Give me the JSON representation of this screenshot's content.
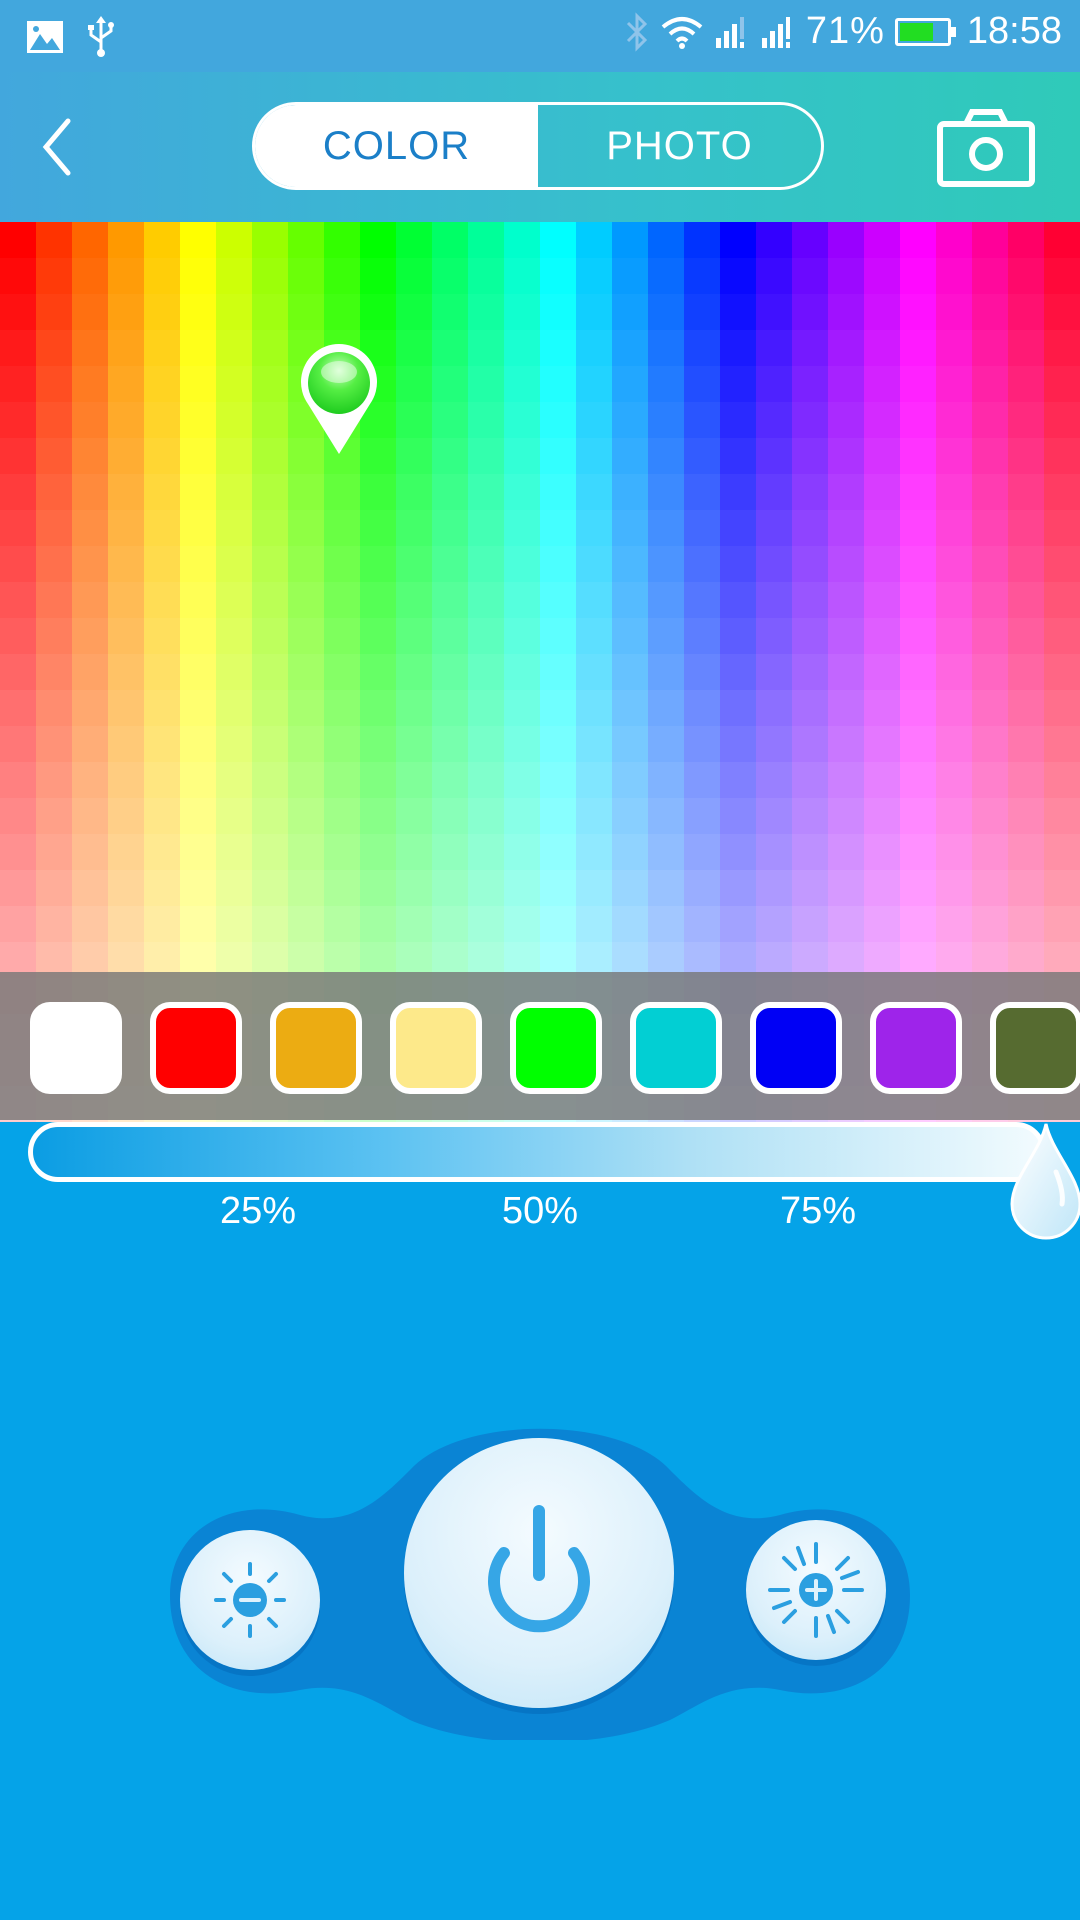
{
  "status_bar": {
    "left_icons": [
      "gallery-icon",
      "usb-icon"
    ],
    "right_icons": [
      "bluetooth-icon",
      "wifi-icon",
      "signal-sim1-icon",
      "signal-sim2-icon"
    ],
    "battery_percent_label": "71%",
    "battery_level": 0.71,
    "battery_color": "#22dd22",
    "time": "18:58"
  },
  "header": {
    "back_icon": "chevron-left-icon",
    "tabs": [
      {
        "label": "COLOR",
        "active": true
      },
      {
        "label": "PHOTO",
        "active": false
      }
    ],
    "camera_icon": "camera-icon",
    "gradient_colors": [
      "#42a7dd",
      "#2fcab9"
    ]
  },
  "color_picker": {
    "hue_columns": 30,
    "selected_color": "#33ee22",
    "picker_icon": "map-pin-icon"
  },
  "swatches": [
    {
      "name": "white",
      "color": "#ffffff"
    },
    {
      "name": "red",
      "color": "#ff0000"
    },
    {
      "name": "orange",
      "color": "#ecac12"
    },
    {
      "name": "light-yellow",
      "color": "#fde98a"
    },
    {
      "name": "green",
      "color": "#00ff00"
    },
    {
      "name": "cyan",
      "color": "#02cfd3"
    },
    {
      "name": "blue",
      "color": "#0000f5"
    },
    {
      "name": "purple",
      "color": "#9e24ea"
    },
    {
      "name": "olive",
      "color": "#566b30"
    }
  ],
  "brightness_slider": {
    "value_percent": 100,
    "tick_labels": [
      "25%",
      "50%",
      "75%"
    ],
    "handle_icon": "water-drop-icon"
  },
  "controls": {
    "brightness_down_icon": "brightness-down-icon",
    "power_icon": "power-icon",
    "brightness_up_icon": "brightness-up-icon"
  }
}
